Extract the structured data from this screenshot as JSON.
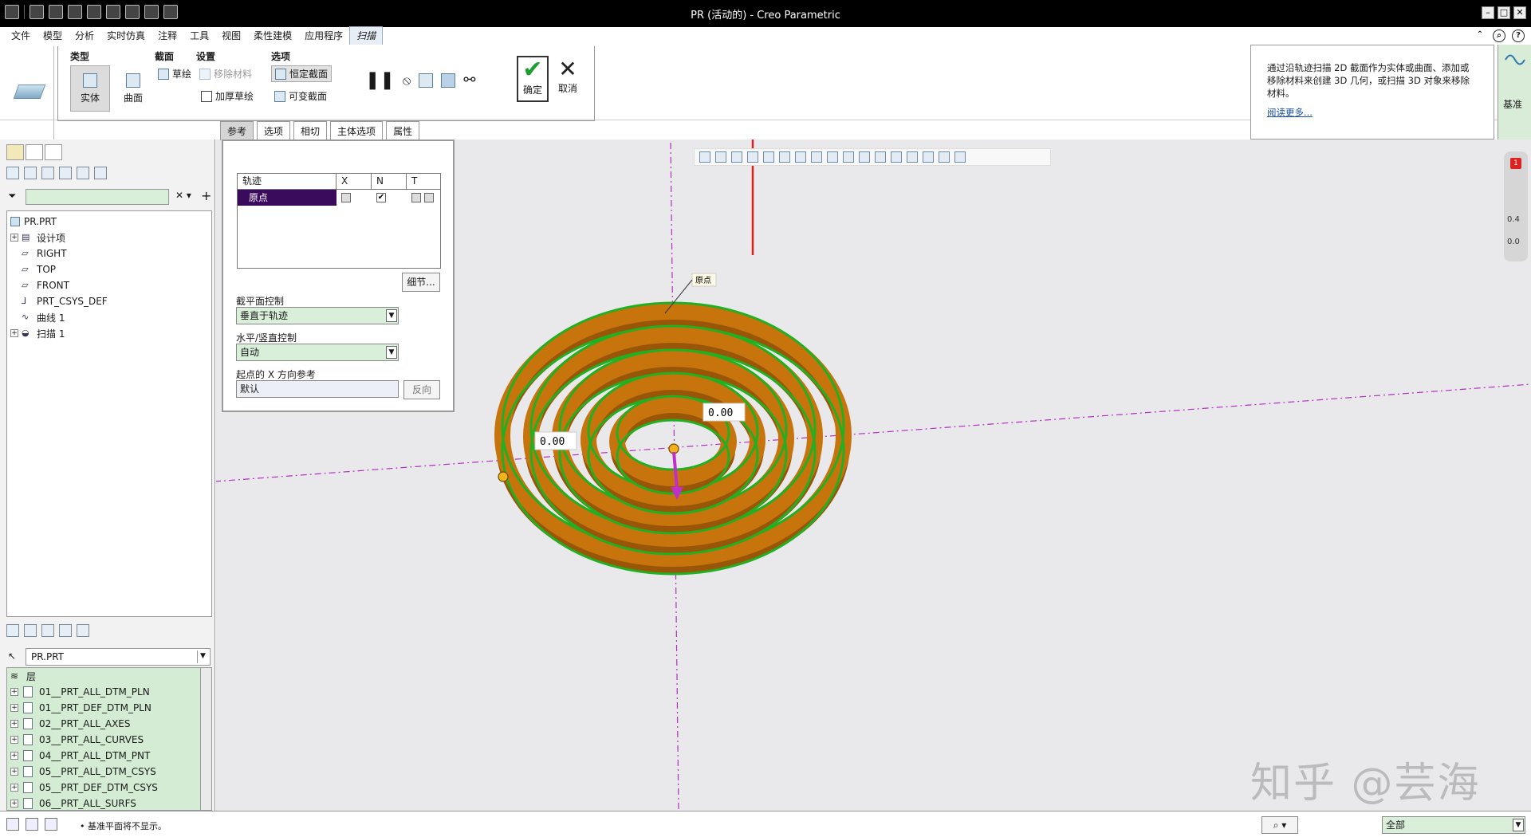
{
  "window": {
    "title": "PR (活动的) - Creo Parametric"
  },
  "menu": {
    "items": [
      "文件",
      "模型",
      "分析",
      "实时仿真",
      "注释",
      "工具",
      "视图",
      "柔性建模",
      "应用程序",
      "扫描"
    ],
    "active": "扫描"
  },
  "ribbon": {
    "groups": {
      "type": "类型",
      "section": "截面",
      "settings": "设置",
      "options": "选项"
    },
    "solid": "实体",
    "surface": "曲面",
    "sketch": "草绘",
    "remove_material": "移除材料",
    "thicken_sketch": "加厚草绘",
    "constant_section": "恒定截面",
    "variable_section": "可变截面",
    "confirm": "确定",
    "cancel": "取消"
  },
  "help": {
    "text": "通过沿轨迹扫描 2D 截面作为实体或曲面、添加或移除材料来创建 3D 几何，或扫描 3D 对象来移除材料。",
    "link": "阅读更多..."
  },
  "datum_panel": {
    "label": "基准"
  },
  "dashboard_tabs": [
    "参考",
    "选项",
    "相切",
    "主体选项",
    "属性"
  ],
  "dashboard_active_tab": "参考",
  "references": {
    "table_headers": [
      "轨迹",
      "X",
      "N",
      "T"
    ],
    "row": {
      "name": "原点",
      "x_checked": false,
      "n_checked": true
    },
    "details_button": "细节...",
    "section_plane_control_label": "截平面控制",
    "section_plane_control_value": "垂直于轨迹",
    "hv_control_label": "水平/竖直控制",
    "hv_control_value": "自动",
    "x_ref_label": "起点的 X 方向参考",
    "x_ref_value": "默认",
    "flip_button": "反向"
  },
  "model_tree": {
    "root": "PR.PRT",
    "items": [
      {
        "label": "设计项",
        "expand": true,
        "icon": "design-items-icon"
      },
      {
        "label": "RIGHT",
        "expand": false,
        "icon": "datum-plane-icon"
      },
      {
        "label": "TOP",
        "expand": false,
        "icon": "datum-plane-icon"
      },
      {
        "label": "FRONT",
        "expand": false,
        "icon": "datum-plane-icon"
      },
      {
        "label": "PRT_CSYS_DEF",
        "expand": false,
        "icon": "csys-icon"
      },
      {
        "label": "曲线 1",
        "expand": false,
        "icon": "curve-icon"
      },
      {
        "label": "扫描 1",
        "expand": true,
        "icon": "sweep-icon"
      }
    ]
  },
  "layers": {
    "selector": "PR.PRT",
    "header": "层",
    "items": [
      "01__PRT_ALL_DTM_PLN",
      "01__PRT_DEF_DTM_PLN",
      "02__PRT_ALL_AXES",
      "03__PRT_ALL_CURVES",
      "04__PRT_ALL_DTM_PNT",
      "05__PRT_ALL_DTM_CSYS",
      "05__PRT_DEF_DTM_CSYS",
      "06__PRT_ALL_SURFS"
    ]
  },
  "graphics": {
    "dim_label_1": "0.00",
    "dim_label_2": "0.00",
    "origin_label": "原点"
  },
  "side_mini": {
    "badge": "1",
    "v1": "0.4",
    "v2": "0.0"
  },
  "watermark": "知乎 @芸海",
  "status": {
    "message": "• 基准平面将不显示。",
    "select_filter": "全部"
  },
  "colors": {
    "sweep_fill": "#c7740c",
    "edge_highlight": "#22b022",
    "selection": "#3a0a5c",
    "datum_axis": "#b030c0",
    "annotation_arrow": "#e02020"
  }
}
